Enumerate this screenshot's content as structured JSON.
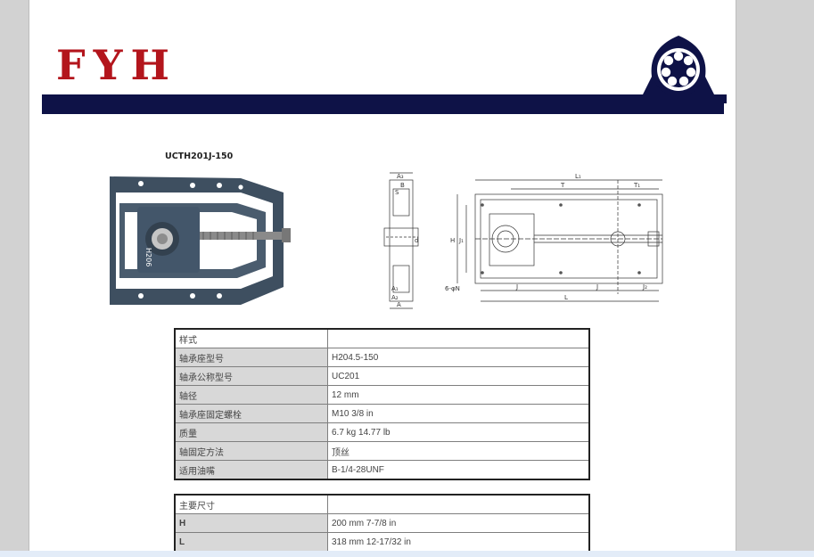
{
  "brand": {
    "logo_text": "FYH",
    "logo_color": "#b3151c",
    "bar_color": "#0e1247",
    "mark_icon": "bearing-housing-icon"
  },
  "product": {
    "model": "UCTH201J-150"
  },
  "drawing_labels": {
    "A3": "A₃",
    "B": "B",
    "S": "S",
    "d": "d",
    "A1": "A₁",
    "A2": "A₂",
    "A": "A",
    "H": "H",
    "J1": "J₁",
    "sixN": "6-φN",
    "L1": "L₁",
    "T": "T",
    "T1": "T₁",
    "J": "J",
    "J2": "J₂",
    "L": "L",
    "housing_mark": "H204.5"
  },
  "spec_table": {
    "rows": [
      {
        "label": "样式",
        "value": ""
      },
      {
        "label": "轴承座型号",
        "value": "H204.5-150"
      },
      {
        "label": "轴承公称型号",
        "value": "UC201"
      },
      {
        "label": "轴径",
        "value": "12 mm"
      },
      {
        "label": "轴承座固定螺栓",
        "value": "M10    3/8 in"
      },
      {
        "label": "质量",
        "value": "6.7 kg    14.77 lb"
      },
      {
        "label": "轴固定方法",
        "value": "顶丝"
      },
      {
        "label": "适用油嘴",
        "value": "B-1/4-28UNF"
      }
    ]
  },
  "dimension_table": {
    "header": "主要尺寸",
    "rows": [
      {
        "label": "H",
        "value": "200 mm    7-7/8 in"
      },
      {
        "label": "L",
        "value": "318 mm    12-17/32 in"
      }
    ]
  }
}
